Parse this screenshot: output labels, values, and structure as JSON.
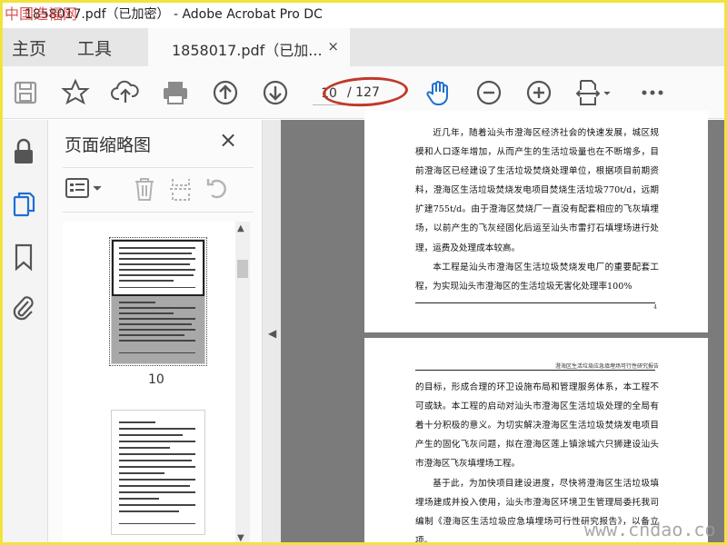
{
  "window": {
    "title": "1858017.pdf（已加密） - Adobe Acrobat Pro DC",
    "watermark_top": "中国造福网"
  },
  "tabs": {
    "home": "主页",
    "tools": "工具",
    "document": "1858017.pdf（已加...",
    "close_glyph": "×"
  },
  "toolbar": {
    "page_current": "10",
    "page_total": "/ 127",
    "icons": [
      "save-icon",
      "bookmark-star-icon",
      "cloud-upload-icon",
      "print-icon",
      "page-up-icon",
      "page-down-icon",
      "hand-tool-icon",
      "zoom-out-icon",
      "zoom-in-icon",
      "fit-page-icon",
      "more-icon"
    ]
  },
  "thumbnail_panel": {
    "title": "页面缩略图",
    "close_glyph": "×",
    "thumb_labels": [
      "10"
    ]
  },
  "document": {
    "page1_paragraph1": "近几年，随着汕头市澄海区经济社会的快速发展，城区规模和人口逐年增加，从而产生的生活垃圾量也在不断增多，目前澄海区已经建设了生活垃圾焚烧处理单位，根据项目前期资料，澄海区生活垃圾焚烧发电项目焚烧生活垃圾770t/d，远期扩建755t/d。由于澄海区焚烧厂一直没有配套相应的飞灰填埋场，以前产生的飞灰经固化后运至汕头市雷打石填埋场进行处理，运费及处理成本较高。",
    "page1_paragraph2": "本工程是汕头市澄海区生活垃圾焚烧发电厂的重要配套工程，为实现汕头市澄海区的生活垃圾无害化处理率100%",
    "page1_number": "4",
    "page2_header": "澄海区生活垃圾应急填埋场可行性研究报告",
    "page2_paragraph1": "的目标，形成合理的环卫设施布局和管理服务体系，本工程不可或缺。本工程的启动对汕头市澄海区生活垃圾处理的全局有着十分积极的意义。为切实解决澄海区生活垃圾焚烧发电项目产生的固化飞灰问题，拟在澄海区莲上镇涂城六只狮建设汕头市澄海区飞灰填埋场工程。",
    "page2_paragraph2": "基于此，为加快项目建设进度，尽快将澄海区生活垃圾填埋场建成并投入使用，汕头市澄海区环境卫生管理局委托我司编制《澄海区生活垃圾应急填埋场可行性研究报告》，以备立项。"
  },
  "footer": {
    "watermark_bottom": "www.cndao.co"
  },
  "colors": {
    "annotation_ellipse": "#c0392b",
    "frame_border": "#f2e33c",
    "accent_blue": "#1f6fd1"
  }
}
